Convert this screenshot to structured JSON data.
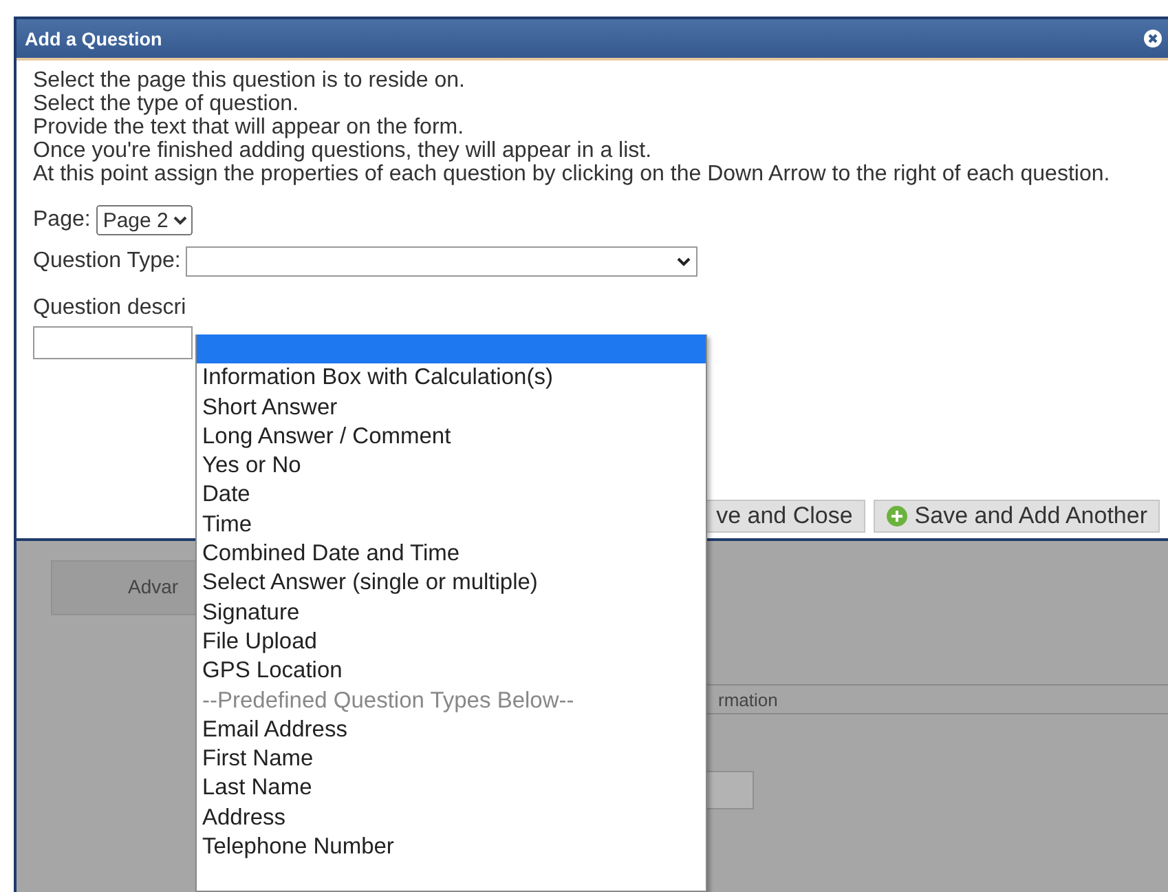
{
  "background": {
    "panel_label": "Advar",
    "field_value": "rmation"
  },
  "dialog": {
    "title": "Add a Question",
    "instructions": [
      "Select the page this question is to reside on.",
      "Select the type of question.",
      "Provide the text that will appear on the form.",
      "Once you're finished adding questions, they will appear in a list.",
      "At this point assign the properties of each question by clicking on the Down Arrow to the right of each question."
    ],
    "page_label": "Page:",
    "page_value": "Page 2",
    "question_type_label": "Question Type:",
    "description_label": "Question descri",
    "buttons": [
      {
        "label": "ve and Close",
        "kind": "plain"
      },
      {
        "label": "Save and Add Another",
        "kind": "add"
      }
    ]
  },
  "dropdown": {
    "blank_option": {
      "selected": true
    },
    "options": [
      {
        "label": "Information Box with Calculation(s)",
        "disabled": false,
        "selected": false
      },
      {
        "label": "Short Answer",
        "disabled": false,
        "selected": false
      },
      {
        "label": "Long Answer / Comment",
        "disabled": false,
        "selected": false
      },
      {
        "label": "Yes or No",
        "disabled": false,
        "selected": false
      },
      {
        "label": "Date",
        "disabled": false,
        "selected": false
      },
      {
        "label": "Time",
        "disabled": false,
        "selected": false
      },
      {
        "label": "Combined Date and Time",
        "disabled": false,
        "selected": false
      },
      {
        "label": "Select Answer (single or multiple)",
        "disabled": false,
        "selected": false
      },
      {
        "label": "Signature",
        "disabled": false,
        "selected": false
      },
      {
        "label": "File Upload",
        "disabled": false,
        "selected": false
      },
      {
        "label": "GPS Location",
        "disabled": false,
        "selected": false
      },
      {
        "label": "--Predefined Question Types Below--",
        "disabled": true,
        "selected": false
      },
      {
        "label": "Email Address",
        "disabled": false,
        "selected": false
      },
      {
        "label": "First Name",
        "disabled": false,
        "selected": false
      },
      {
        "label": "Last Name",
        "disabled": false,
        "selected": false
      },
      {
        "label": "Address",
        "disabled": false,
        "selected": false
      },
      {
        "label": "Telephone Number",
        "disabled": false,
        "selected": false
      }
    ]
  }
}
